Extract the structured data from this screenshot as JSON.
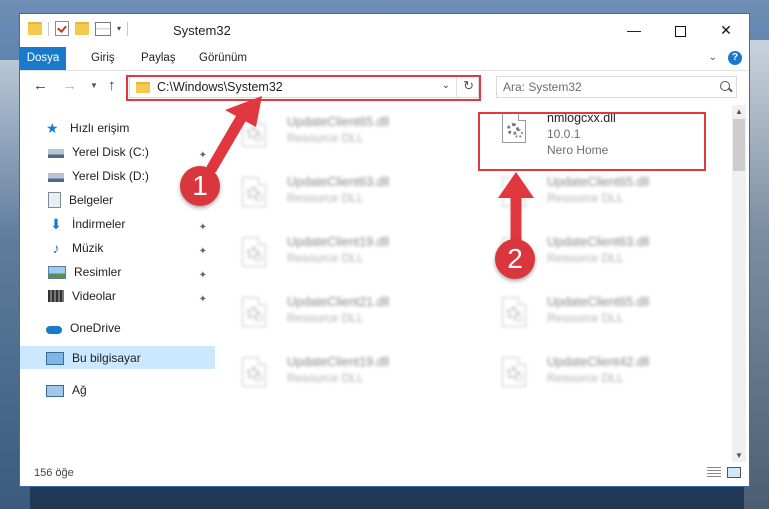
{
  "window": {
    "title": "System32",
    "controls": {
      "minimize": "—",
      "maximize": "",
      "close": "✕"
    }
  },
  "ribbon": {
    "tabs": [
      {
        "label": "Dosya",
        "active": true
      },
      {
        "label": "Giriş"
      },
      {
        "label": "Paylaş"
      },
      {
        "label": "Görünüm"
      }
    ],
    "help": "?"
  },
  "navigation": {
    "back": "←",
    "forward": "→",
    "recent": "⌄",
    "up": "↑",
    "address": "C:\\Windows\\System32",
    "address_dropdown": "⌄",
    "refresh": "↻",
    "search_placeholder": "Ara: System32"
  },
  "sidebar": {
    "items": [
      {
        "label": "Hızlı erişim",
        "icon": "star-icon"
      },
      {
        "label": "Yerel Disk (C:)",
        "icon": "drive-icon",
        "pinned": true
      },
      {
        "label": "Yerel Disk (D:)",
        "icon": "drive-icon"
      },
      {
        "label": "Belgeler",
        "icon": "documents-icon"
      },
      {
        "label": "İndirmeler",
        "icon": "downloads-icon",
        "pinned": true
      },
      {
        "label": "Müzik",
        "icon": "music-icon",
        "pinned": true
      },
      {
        "label": "Resimler",
        "icon": "pictures-icon",
        "pinned": true
      },
      {
        "label": "Videolar",
        "icon": "videos-icon",
        "pinned": true
      },
      {
        "label": "OneDrive",
        "icon": "cloud-icon"
      },
      {
        "label": "Bu bilgisayar",
        "icon": "computer-icon",
        "selected": true
      },
      {
        "label": "Ağ",
        "icon": "network-icon"
      }
    ],
    "pin_glyph": "📌"
  },
  "files": {
    "highlighted": {
      "name": "nmlogcxx.dll",
      "version": "10.0.1",
      "company": "Nero Home"
    },
    "left_column": [
      {
        "name": "UpdateClient65.dll",
        "type": "Resource DLL"
      },
      {
        "name": "UpdateClient63.dll",
        "type": "Resource DLL"
      },
      {
        "name": "UpdateClient19.dll",
        "type": "Resource DLL"
      },
      {
        "name": "UpdateClient21.dll",
        "type": "Resource DLL"
      },
      {
        "name": "UpdateClient19.dll",
        "type": "Resource DLL"
      }
    ],
    "right_column": [
      {
        "name": "UpdateClient65.dll",
        "type": "Resource DLL"
      },
      {
        "name": "UpdateClient63.dll",
        "type": "Resource DLL"
      },
      {
        "name": "UpdateClient65.dll",
        "type": "Resource DLL"
      },
      {
        "name": "UpdateClient42.dll",
        "type": "Resource DLL"
      }
    ]
  },
  "status": {
    "item_count": "156 öğe"
  },
  "annotations": {
    "step1": "1",
    "step2": "2",
    "color": "#d9363e"
  }
}
